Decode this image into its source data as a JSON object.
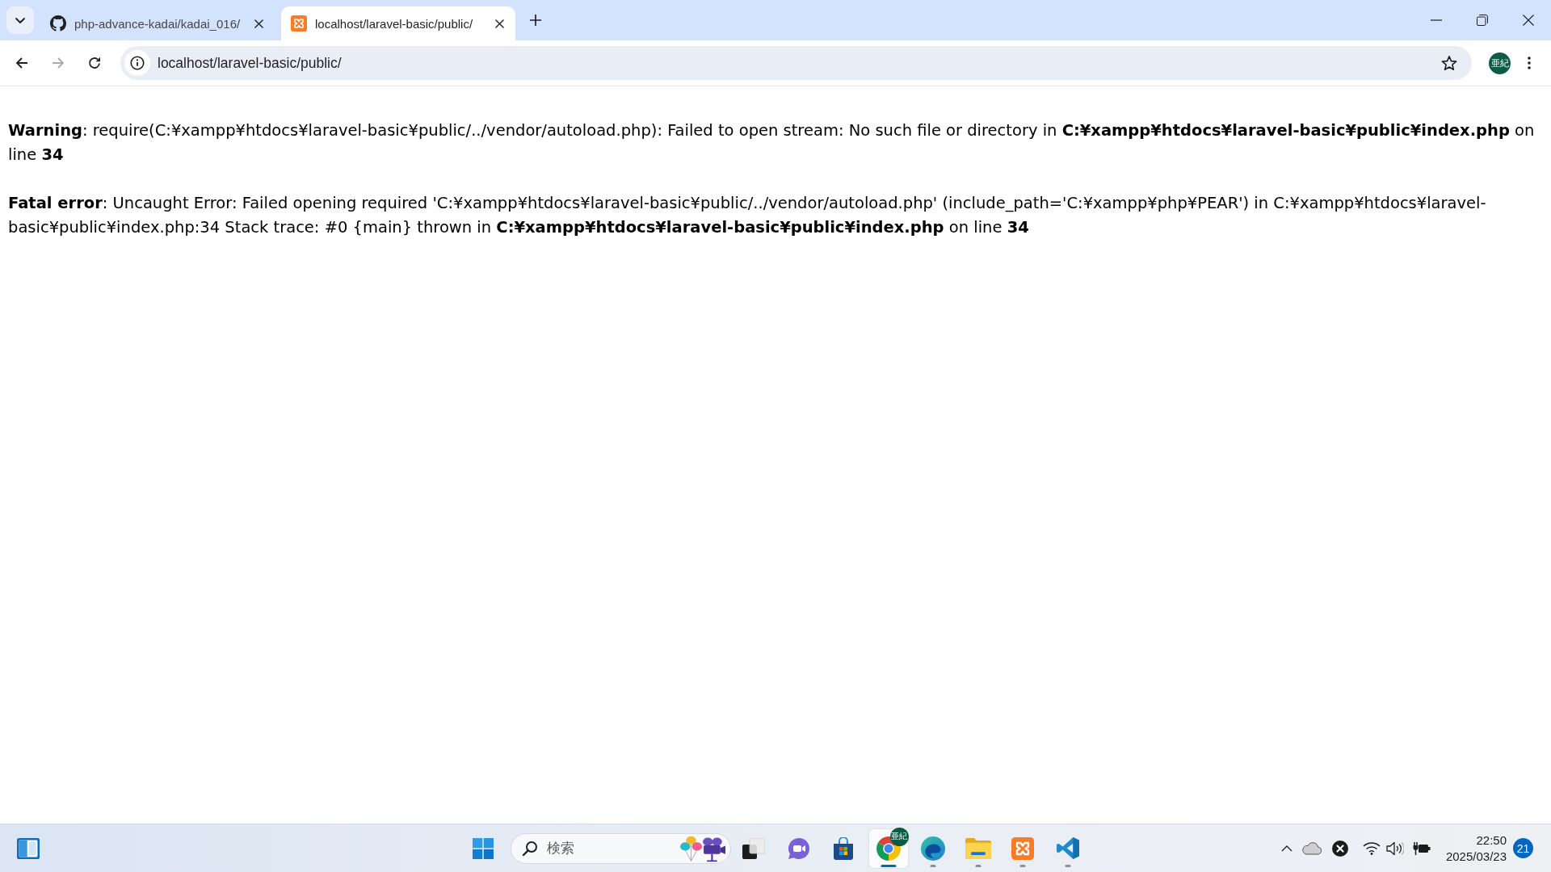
{
  "browser": {
    "tabs": [
      {
        "title": "php-advance-kadai/kadai_016/",
        "kind": "github",
        "selected": false
      },
      {
        "title": "localhost/laravel-basic/public/",
        "kind": "xampp",
        "selected": true
      }
    ],
    "nav_buttons": [
      {
        "kind": "back",
        "disabled": false
      },
      {
        "kind": "forward",
        "disabled": true
      },
      {
        "kind": "reload",
        "disabled": false
      }
    ],
    "address_bar": {
      "url": "localhost/laravel-basic/public/"
    },
    "profile": {
      "initials": "亜紀"
    }
  },
  "page": {
    "messages": [
      "**Warning**: require(C:¥xampp¥htdocs¥laravel-basic¥public/../vendor/autoload.php): Failed to open stream: No such file or directory in **C:¥xampp¥htdocs¥laravel-basic¥public¥index.php** on line **34**",
      "**Fatal error**: Uncaught Error: Failed opening required 'C:¥xampp¥htdocs¥laravel-basic¥public/../vendor/autoload.php' (include_path='C:¥xampp¥php¥PEAR') in C:¥xampp¥htdocs¥laravel-basic¥public¥index.php:34 Stack trace: #0 {main} thrown in **C:¥xampp¥htdocs¥laravel-basic¥public¥index.php** on line **34**"
    ]
  },
  "taskbar": {
    "search": {
      "placeholder": "検索"
    },
    "apps": [
      {
        "kind": "task_view",
        "running": false,
        "focused": false
      },
      {
        "kind": "chat",
        "running": false,
        "focused": false
      },
      {
        "kind": "store",
        "running": false,
        "focused": false
      },
      {
        "kind": "chrome",
        "running": true,
        "focused": true,
        "badge": "亜紀"
      },
      {
        "kind": "edge",
        "running": true,
        "focused": false
      },
      {
        "kind": "explorer",
        "running": true,
        "focused": false
      },
      {
        "kind": "xampp",
        "running": true,
        "focused": false
      },
      {
        "kind": "vscode",
        "running": true,
        "focused": false
      }
    ],
    "clock": {
      "time": "22:50",
      "date": "2025/03/23"
    },
    "notifications": {
      "count": "21"
    }
  }
}
